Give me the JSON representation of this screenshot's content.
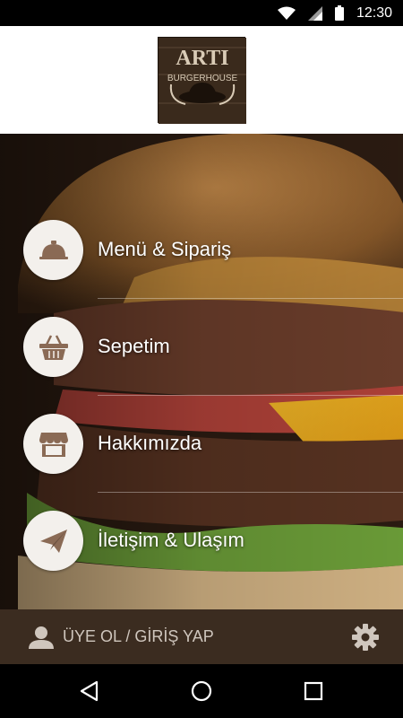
{
  "status_bar": {
    "time": "12:30",
    "icons": [
      "wifi-icon",
      "cellular-signal-icon",
      "battery-icon"
    ]
  },
  "header": {
    "logo_alt": "ARTI BURGERHOUSE"
  },
  "menu": {
    "items": [
      {
        "label": "Menü & Sipariş",
        "icon": "cloche-icon"
      },
      {
        "label": "Sepetim",
        "icon": "basket-icon"
      },
      {
        "label": "Hakkımızda",
        "icon": "storefront-icon"
      },
      {
        "label": "İletişim & Ulaşım",
        "icon": "paper-plane-icon"
      }
    ]
  },
  "footer": {
    "login_label": "ÜYE OL / GİRİŞ YAP",
    "settings_icon": "gear-icon"
  },
  "colors": {
    "footer_bg": "#3b2c20",
    "circle_bg": "#f3f0ec",
    "icon_brown": "#8a6a55",
    "status_bg": "#000000"
  }
}
